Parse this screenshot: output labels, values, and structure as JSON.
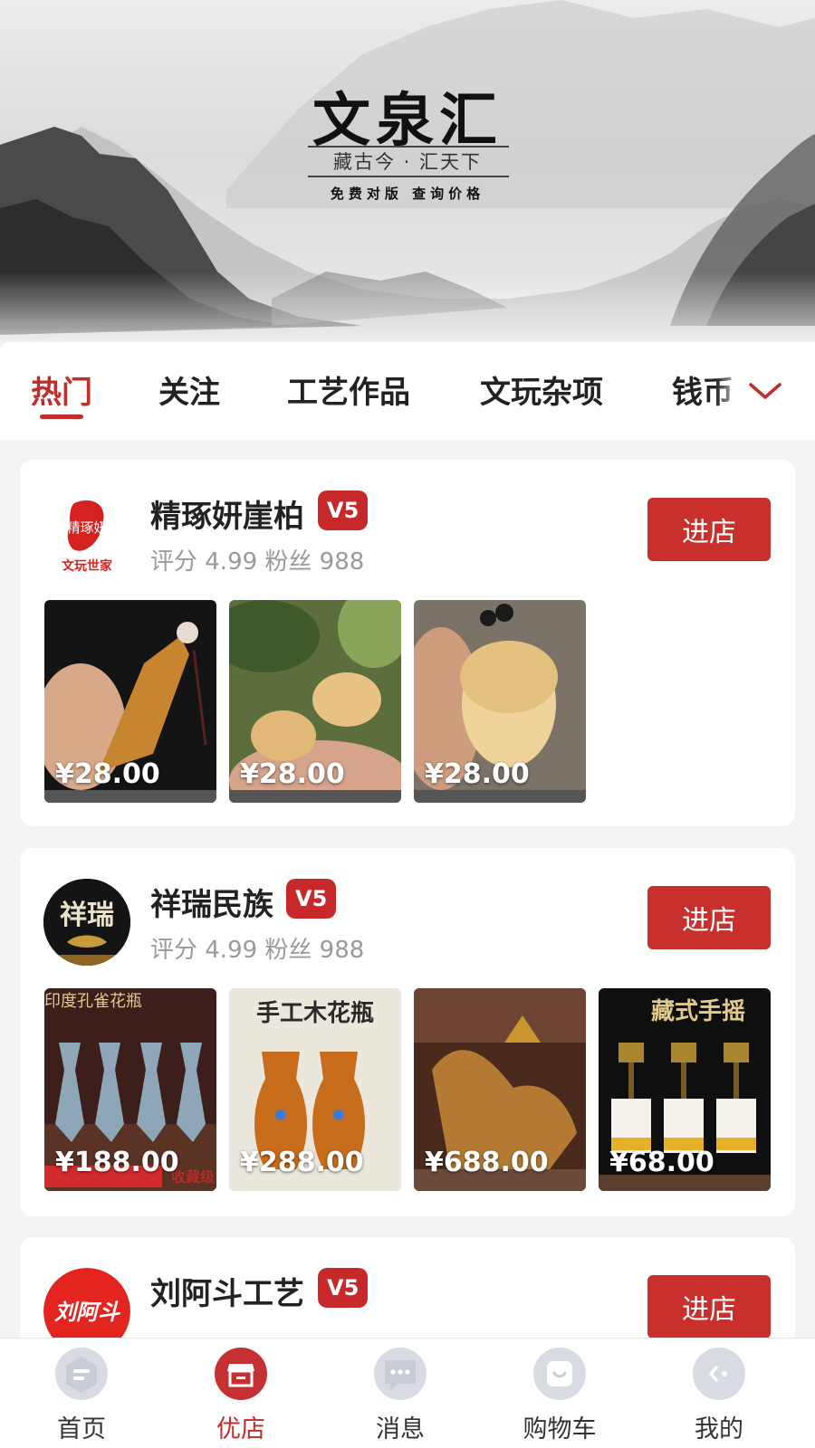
{
  "banner": {
    "title": "文泉汇",
    "slogan": "藏古今 · 汇天下",
    "subtitle": "免费对版  查询价格"
  },
  "tabs": [
    "热门",
    "关注",
    "工艺作品",
    "文玩杂项",
    "钱币"
  ],
  "active_tab": "热门",
  "tab_more_icon": "chevron-down-icon",
  "shops": [
    {
      "name": "精琢妍崖柏",
      "badge": "V5",
      "logo_text": "精琢妍",
      "logo_caption": "文玩世家",
      "meta": "评分 4.99 粉丝 988",
      "enter_label": "进店",
      "products": [
        {
          "price": "¥28.00"
        },
        {
          "price": "¥28.00"
        },
        {
          "price": "¥28.00"
        }
      ]
    },
    {
      "name": "祥瑞民族",
      "badge": "V5",
      "logo_text": "祥瑞",
      "meta": "评分 4.99 粉丝 988",
      "enter_label": "进店",
      "products": [
        {
          "price": "¥188.00",
          "overlay": "印度孔雀花瓶",
          "overlay_right": "收藏级"
        },
        {
          "price": "¥288.00",
          "heading": "手工木花瓶"
        },
        {
          "price": "¥688.00"
        },
        {
          "price": "¥68.00",
          "heading": "藏式手摇"
        }
      ]
    },
    {
      "name": "刘阿斗工艺",
      "badge": "V5",
      "logo_text": "刘阿斗",
      "enter_label": "进店"
    }
  ],
  "bottom_nav": [
    {
      "label": "首页",
      "icon": "home-icon"
    },
    {
      "label": "优店",
      "icon": "shop-icon",
      "active": true
    },
    {
      "label": "消息",
      "icon": "message-icon"
    },
    {
      "label": "购物车",
      "icon": "cart-icon"
    },
    {
      "label": "我的",
      "icon": "profile-icon"
    }
  ],
  "colors": {
    "accent": "#c42b2b",
    "button": "#c9302c",
    "badge": "#c7292b",
    "nav_inactive_icon": "#d9dbe3"
  }
}
